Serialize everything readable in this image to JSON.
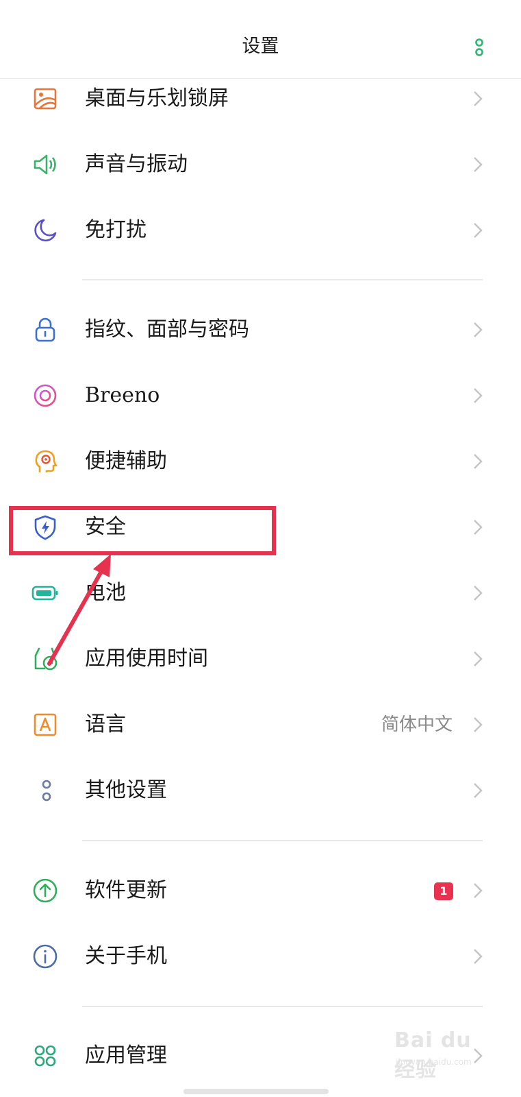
{
  "header": {
    "title": "设置",
    "more_icon": "more-vertical-icon"
  },
  "accent_color": "#2bb673",
  "highlight_color": "#e5324f",
  "items": [
    {
      "label": "桌面与乐划锁屏",
      "icon": "wallpaper-icon",
      "color": "#e8763a"
    },
    {
      "label": "声音与振动",
      "icon": "speaker-icon",
      "color": "#3bb26b"
    },
    {
      "label": "免打扰",
      "icon": "moon-icon",
      "color": "#5b4fc7"
    },
    {
      "label": "指纹、面部与密码",
      "icon": "lock-icon",
      "color": "#3b6fd1"
    },
    {
      "label": "Breeno",
      "icon": "breeno-icon",
      "color": "#e04fa0"
    },
    {
      "label": "便捷辅助",
      "icon": "assist-icon",
      "color": "#f0a020"
    },
    {
      "label": "安全",
      "icon": "shield-icon",
      "color": "#3b5fc9"
    },
    {
      "label": "电池",
      "icon": "battery-icon",
      "color": "#1fb59a"
    },
    {
      "label": "应用使用时间",
      "icon": "app-time-icon",
      "color": "#2fae5c"
    },
    {
      "label": "语言",
      "icon": "language-icon",
      "color": "#f08a2a",
      "value": "简体中文"
    },
    {
      "label": "其他设置",
      "icon": "other-settings-icon",
      "color": "#6a7aa0"
    },
    {
      "label": "软件更新",
      "icon": "update-icon",
      "color": "#2fae5c",
      "badge": "1"
    },
    {
      "label": "关于手机",
      "icon": "info-icon",
      "color": "#4a6aa8"
    },
    {
      "label": "应用管理",
      "icon": "app-manage-icon",
      "color": "#2aa87a"
    }
  ],
  "watermark": {
    "text": "Bai du 经验",
    "sub": "jingyan.baidu.com"
  }
}
